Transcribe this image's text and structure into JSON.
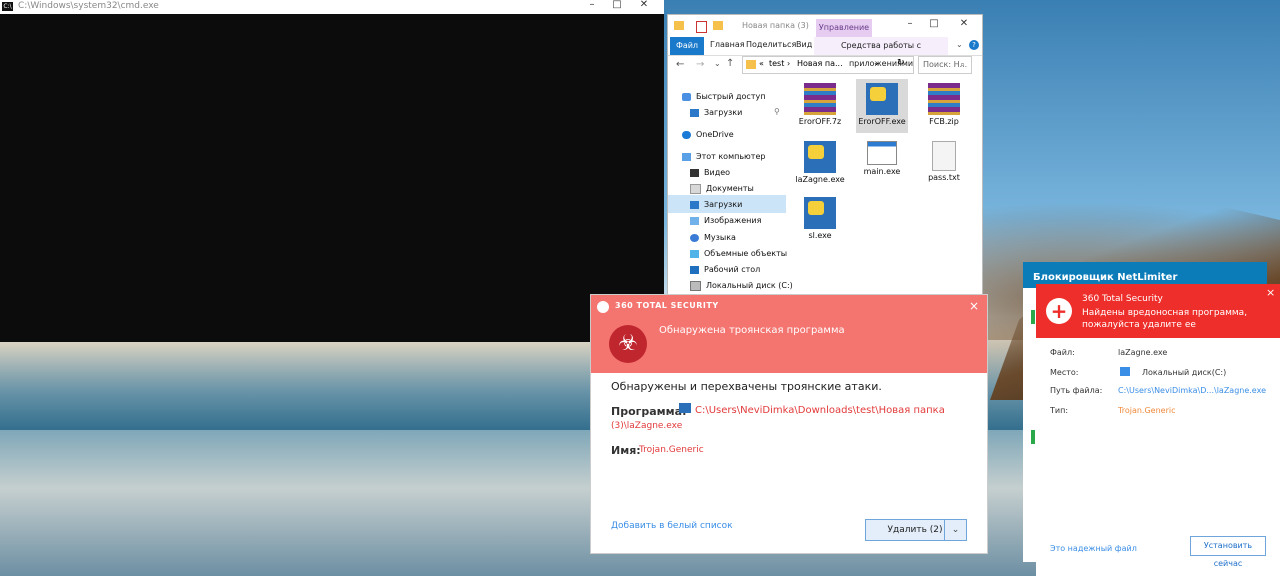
{
  "cmd": {
    "title": "C:\\Windows\\system32\\cmd.exe"
  },
  "explorer": {
    "title": "Новая папка (3)",
    "manage_tab": "Управление",
    "ribbon_tabs": [
      "Файл",
      "Главная",
      "Поделиться",
      "Вид"
    ],
    "tools_tab": "Средства работы с приложениями",
    "address": [
      "«",
      "test",
      "›",
      "Новая па..."
    ],
    "search_placeholder": "Поиск: Н...",
    "nav": [
      "Быстрый доступ",
      "Загрузки",
      "OneDrive",
      "Этот компьютер",
      "Видео",
      "Документы",
      "Загрузки",
      "Изображения",
      "Музыка",
      "Объемные объекты",
      "Рабочий стол",
      "Локальный диск (C:)"
    ],
    "files": [
      {
        "name": "ErorOFF.7z",
        "icon": "winrar-archive-icon"
      },
      {
        "name": "ErorOFF.exe",
        "icon": "exe-icon"
      },
      {
        "name": "FCB.zip",
        "icon": "winrar-archive-icon"
      },
      {
        "name": "laZagne.exe",
        "icon": "exe-icon"
      },
      {
        "name": "main.exe",
        "icon": "window-exe-icon"
      },
      {
        "name": "pass.txt",
        "icon": "text-file-icon"
      },
      {
        "name": "sl.exe",
        "icon": "exe-icon"
      }
    ]
  },
  "dialog": {
    "brand": "360 TOTAL SECURITY",
    "title": "Обнаружена троянская программа",
    "message": "Обнаружены и перехвачены троянские атаки.",
    "program_label": "Программа:",
    "program_path_1": "C:\\Users\\NeviDimka\\Downloads\\test\\Новая папка",
    "program_path_2": "(3)\\laZagne.exe",
    "name_label": "Имя:",
    "name_value": "Trojan.Generic",
    "whitelist": "Добавить в белый список",
    "delete_button": "Удалить (2)"
  },
  "netlimiter": {
    "title": "Блокировщик NetLimiter"
  },
  "toast": {
    "brand": "360 Total Security",
    "message": "Найдены вредоносная программа, пожалуйста удалите ее",
    "file_label": "Файл:",
    "file_value": "laZagne.exe",
    "place_label": "Место:",
    "place_value": "Локальный диск(C:)",
    "path_label": "Путь файла:",
    "path_value": "C:\\Users\\NeviDimka\\D...\\laZagne.exe",
    "type_label": "Тип:",
    "type_value": "Trojan.Generic",
    "safe_link": "Это надежный файл",
    "install_button": "Установить сейчас"
  },
  "colors": {
    "dialog_header": "#f47470",
    "toast_header": "#ee2e2a",
    "link": "#3a8ee6"
  }
}
